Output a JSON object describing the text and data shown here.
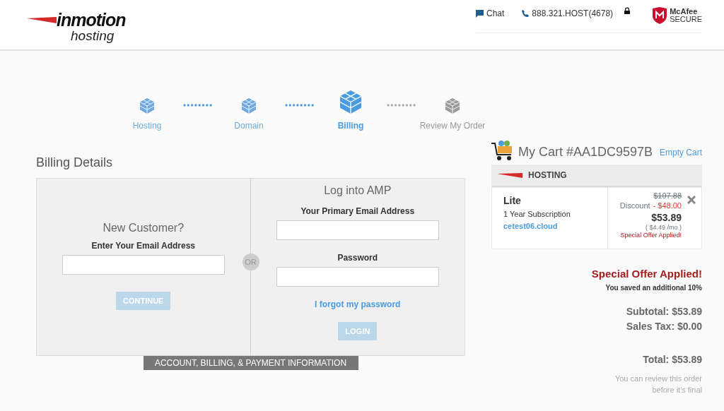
{
  "header": {
    "logo": {
      "brand": "inmotion",
      "sub": "hosting"
    },
    "chat": "Chat",
    "phone": "888.321.HOST(4678)",
    "badge": {
      "brand": "McAfee",
      "sub": "SECURE"
    }
  },
  "steps": [
    {
      "label": "Hosting",
      "selected": false,
      "completed": true
    },
    {
      "label": "Domain",
      "selected": false,
      "completed": true
    },
    {
      "label": "Billing",
      "selected": true,
      "completed": false
    },
    {
      "label": "Review My Order",
      "selected": false,
      "completed": false
    }
  ],
  "billing": {
    "title": "Billing Details",
    "new_customer": {
      "heading": "New Customer?",
      "label": "Enter Your Email Address",
      "button": {
        "label": "CONTINUE",
        "disabled": true
      }
    },
    "divider": "OR",
    "login": {
      "heading": "Log into AMP",
      "email_label": "Your Primary Email Address",
      "password_label": "Password",
      "forgot": "I forgot my password",
      "button": {
        "label": "LOGIN",
        "disabled": true
      }
    },
    "footer_tab": "ACCOUNT, BILLING, & PAYMENT INFORMATION"
  },
  "cart": {
    "title": "My Cart #AA1DC9597B",
    "empty": "Empty Cart",
    "section": "HOSTING",
    "item": {
      "name": "Lite",
      "term": "1 Year Subscription",
      "domain": "cetest06.cloud",
      "old_price": "$107.88",
      "discount_label": "Discount",
      "discount": "- $48.00",
      "price": "$53.89",
      "monthly": "( $4.49 /mo )",
      "offer": "Special Offer Applied!"
    },
    "offer_title": "Special Offer Applied!",
    "offer_note": "You saved an additional 10%",
    "subtotal": "Subtotal: $53.89",
    "tax": "Sales Tax: $0.00",
    "total": "Total: $53.89",
    "note": "You can review this order before it's final"
  }
}
